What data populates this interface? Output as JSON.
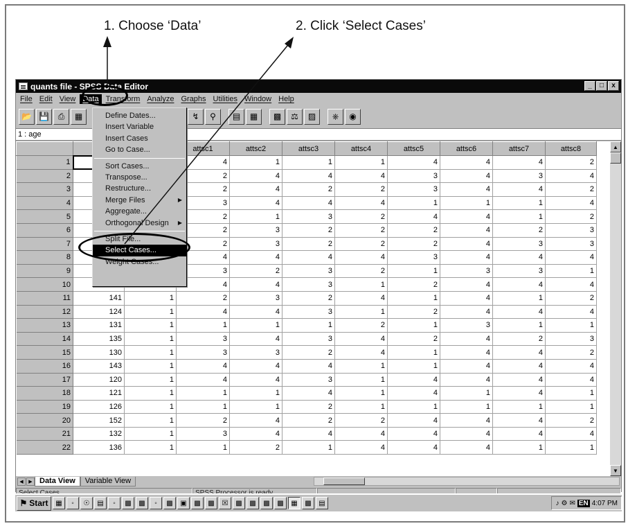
{
  "annotations": {
    "step1": "1. Choose ‘Data’",
    "step2": "2. Click ‘Select Cases’"
  },
  "window": {
    "title": "quants file - SPSS Data Editor",
    "controls": [
      "_",
      "□",
      "x"
    ]
  },
  "menubar": [
    "File",
    "Edit",
    "View",
    "Data",
    "Transform",
    "Analyze",
    "Graphs",
    "Utilities",
    "Window",
    "Help"
  ],
  "active_menu": "Data",
  "cell_ref": "1 : age",
  "data_menu": {
    "group1": [
      "Define Dates...",
      "Insert Variable",
      "Insert Cases",
      "Go to Case..."
    ],
    "group2": [
      "Sort Cases...",
      "Transpose...",
      "Restructure...",
      "Merge Files",
      "Aggregate...",
      "Orthogonal Design"
    ],
    "group3": [
      "Split File...",
      "Select Cases...",
      "Weight Cases..."
    ],
    "selected": "Select Cases..."
  },
  "columns": [
    "age",
    "",
    "attsc1",
    "attsc2",
    "attsc3",
    "attsc4",
    "attsc5",
    "attsc6",
    "attsc7",
    "attsc8"
  ],
  "rows": [
    [
      "1",
      "",
      "",
      "4",
      "1",
      "1",
      "1",
      "4",
      "4",
      "4",
      "2"
    ],
    [
      "2",
      "",
      "",
      "2",
      "4",
      "4",
      "4",
      "3",
      "4",
      "3",
      "4"
    ],
    [
      "3",
      "",
      "",
      "2",
      "4",
      "2",
      "2",
      "3",
      "4",
      "4",
      "2"
    ],
    [
      "4",
      "",
      "",
      "3",
      "4",
      "4",
      "4",
      "1",
      "1",
      "1",
      "4"
    ],
    [
      "5",
      "",
      "",
      "2",
      "1",
      "3",
      "2",
      "4",
      "4",
      "1",
      "2"
    ],
    [
      "6",
      "",
      "",
      "2",
      "3",
      "2",
      "2",
      "2",
      "4",
      "2",
      "3"
    ],
    [
      "7",
      "",
      "",
      "2",
      "3",
      "2",
      "2",
      "2",
      "4",
      "3",
      "3"
    ],
    [
      "8",
      "",
      "",
      "4",
      "4",
      "4",
      "4",
      "3",
      "4",
      "4",
      "4"
    ],
    [
      "9",
      "",
      "",
      "3",
      "2",
      "3",
      "2",
      "1",
      "3",
      "3",
      "1"
    ],
    [
      "10",
      "121",
      "1",
      "4",
      "4",
      "3",
      "1",
      "2",
      "4",
      "4",
      "4"
    ],
    [
      "11",
      "141",
      "1",
      "2",
      "3",
      "2",
      "4",
      "1",
      "4",
      "1",
      "2"
    ],
    [
      "12",
      "124",
      "1",
      "4",
      "4",
      "3",
      "1",
      "2",
      "4",
      "4",
      "4"
    ],
    [
      "13",
      "131",
      "1",
      "1",
      "1",
      "1",
      "2",
      "1",
      "3",
      "1",
      "1"
    ],
    [
      "14",
      "135",
      "1",
      "3",
      "4",
      "3",
      "4",
      "2",
      "4",
      "2",
      "3"
    ],
    [
      "15",
      "130",
      "1",
      "3",
      "3",
      "2",
      "4",
      "1",
      "4",
      "4",
      "2"
    ],
    [
      "16",
      "143",
      "1",
      "4",
      "4",
      "4",
      "1",
      "1",
      "4",
      "4",
      "4"
    ],
    [
      "17",
      "120",
      "1",
      "4",
      "4",
      "3",
      "1",
      "4",
      "4",
      "4",
      "4"
    ],
    [
      "18",
      "121",
      "1",
      "1",
      "1",
      "4",
      "1",
      "4",
      "1",
      "4",
      "1"
    ],
    [
      "19",
      "126",
      "1",
      "1",
      "1",
      "2",
      "1",
      "1",
      "1",
      "1",
      "1"
    ],
    [
      "20",
      "152",
      "1",
      "2",
      "4",
      "2",
      "2",
      "4",
      "4",
      "4",
      "2"
    ],
    [
      "21",
      "132",
      "1",
      "3",
      "4",
      "4",
      "4",
      "4",
      "4",
      "4",
      "4"
    ],
    [
      "22",
      "136",
      "1",
      "1",
      "2",
      "1",
      "4",
      "4",
      "4",
      "1",
      "1"
    ]
  ],
  "tabs": {
    "data_view": "Data View",
    "variable_view": "Variable View"
  },
  "status": {
    "left": "Select Cases",
    "middle": "SPSS Processor  is ready"
  },
  "taskbar": {
    "start": "Start",
    "clock": "4:07 PM",
    "lang": "EN"
  }
}
